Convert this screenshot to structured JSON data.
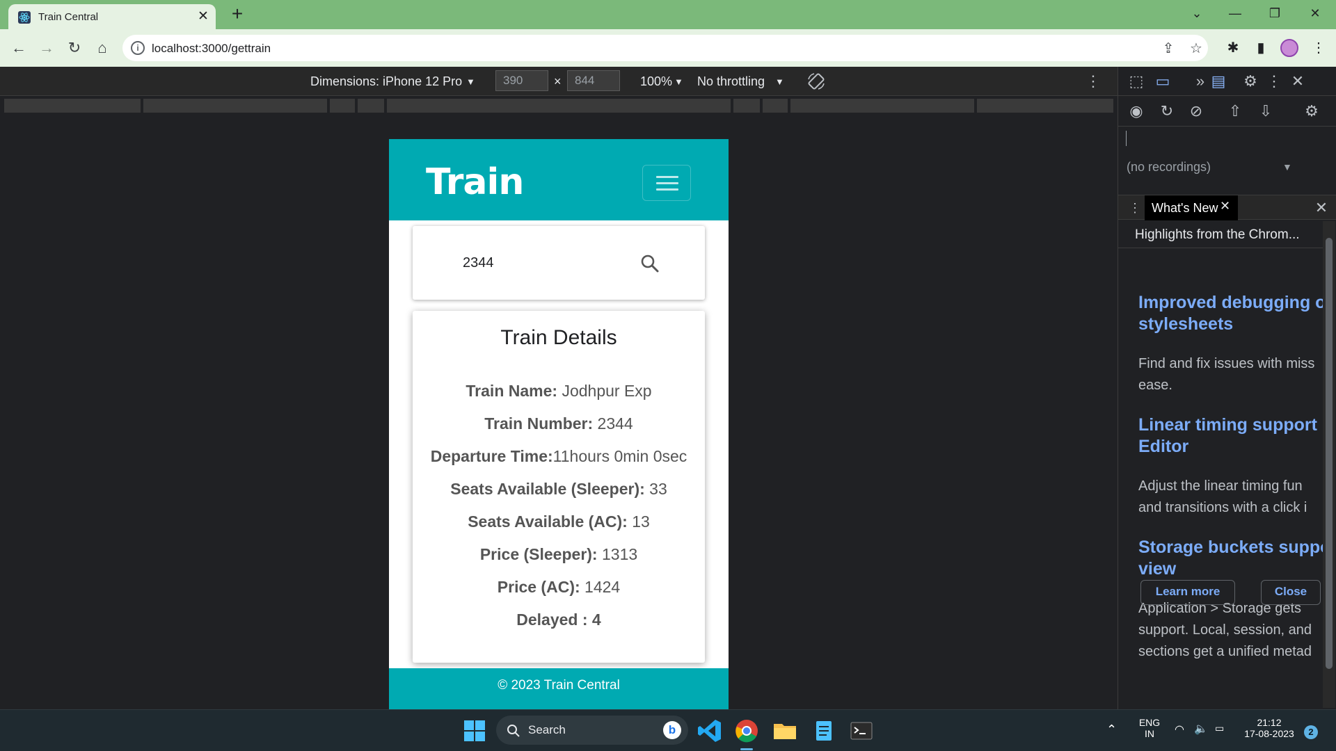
{
  "browser": {
    "tab_title": "Train Central",
    "tab_close": "✕",
    "new_tab": "+",
    "url": "localhost:3000/gettrain"
  },
  "device_toolbar": {
    "dimensions_label": "Dimensions: iPhone 12 Pro",
    "width": "390",
    "times": "×",
    "height": "844",
    "zoom": "100%",
    "throttling": "No throttling"
  },
  "app": {
    "brand": "Train",
    "search": {
      "value": "2344"
    },
    "details": {
      "title": "Train Details",
      "rows": [
        {
          "label": "Train Name:",
          "value": " Jodhpur Exp"
        },
        {
          "label": "Train Number:",
          "value": " 2344"
        },
        {
          "label": "Departure Time:",
          "value": "11hours 0min 0sec"
        },
        {
          "label": "Seats Available (Sleeper):",
          "value": " 33"
        },
        {
          "label": "Seats Available (AC):",
          "value": " 13"
        },
        {
          "label": "Price (Sleeper):",
          "value": " 1313"
        },
        {
          "label": "Price (AC):",
          "value": " 1424"
        },
        {
          "label": "Delayed : 4",
          "value": ""
        }
      ]
    },
    "footer": "© 2023 Train Central",
    "colors": {
      "brand": "#00aab2"
    }
  },
  "devtools": {
    "no_recordings": "(no recordings)",
    "whats_new_tab": "What's New",
    "highlights": "Highlights from the Chrom...",
    "items": [
      {
        "heading_1": "Improved debugging o",
        "heading_2": "stylesheets",
        "body_1": "Find and fix issues with miss",
        "body_2": "ease."
      },
      {
        "heading_1": "Linear timing support",
        "heading_2": "Editor",
        "body_1": "Adjust the linear timing fun",
        "body_2": "and transitions with a click i"
      },
      {
        "heading_1": "Storage buckets suppo",
        "heading_2": "view",
        "body_1": "Application > Storage gets",
        "body_2": "support. Local, session, and",
        "body_3": "sections get a unified metad"
      }
    ],
    "learn_more": "Learn more",
    "close": "Close"
  },
  "taskbar": {
    "search_label": "Search",
    "lang_1": "ENG",
    "lang_2": "IN",
    "time": "21:12",
    "date": "17-08-2023",
    "notifications": "2"
  }
}
